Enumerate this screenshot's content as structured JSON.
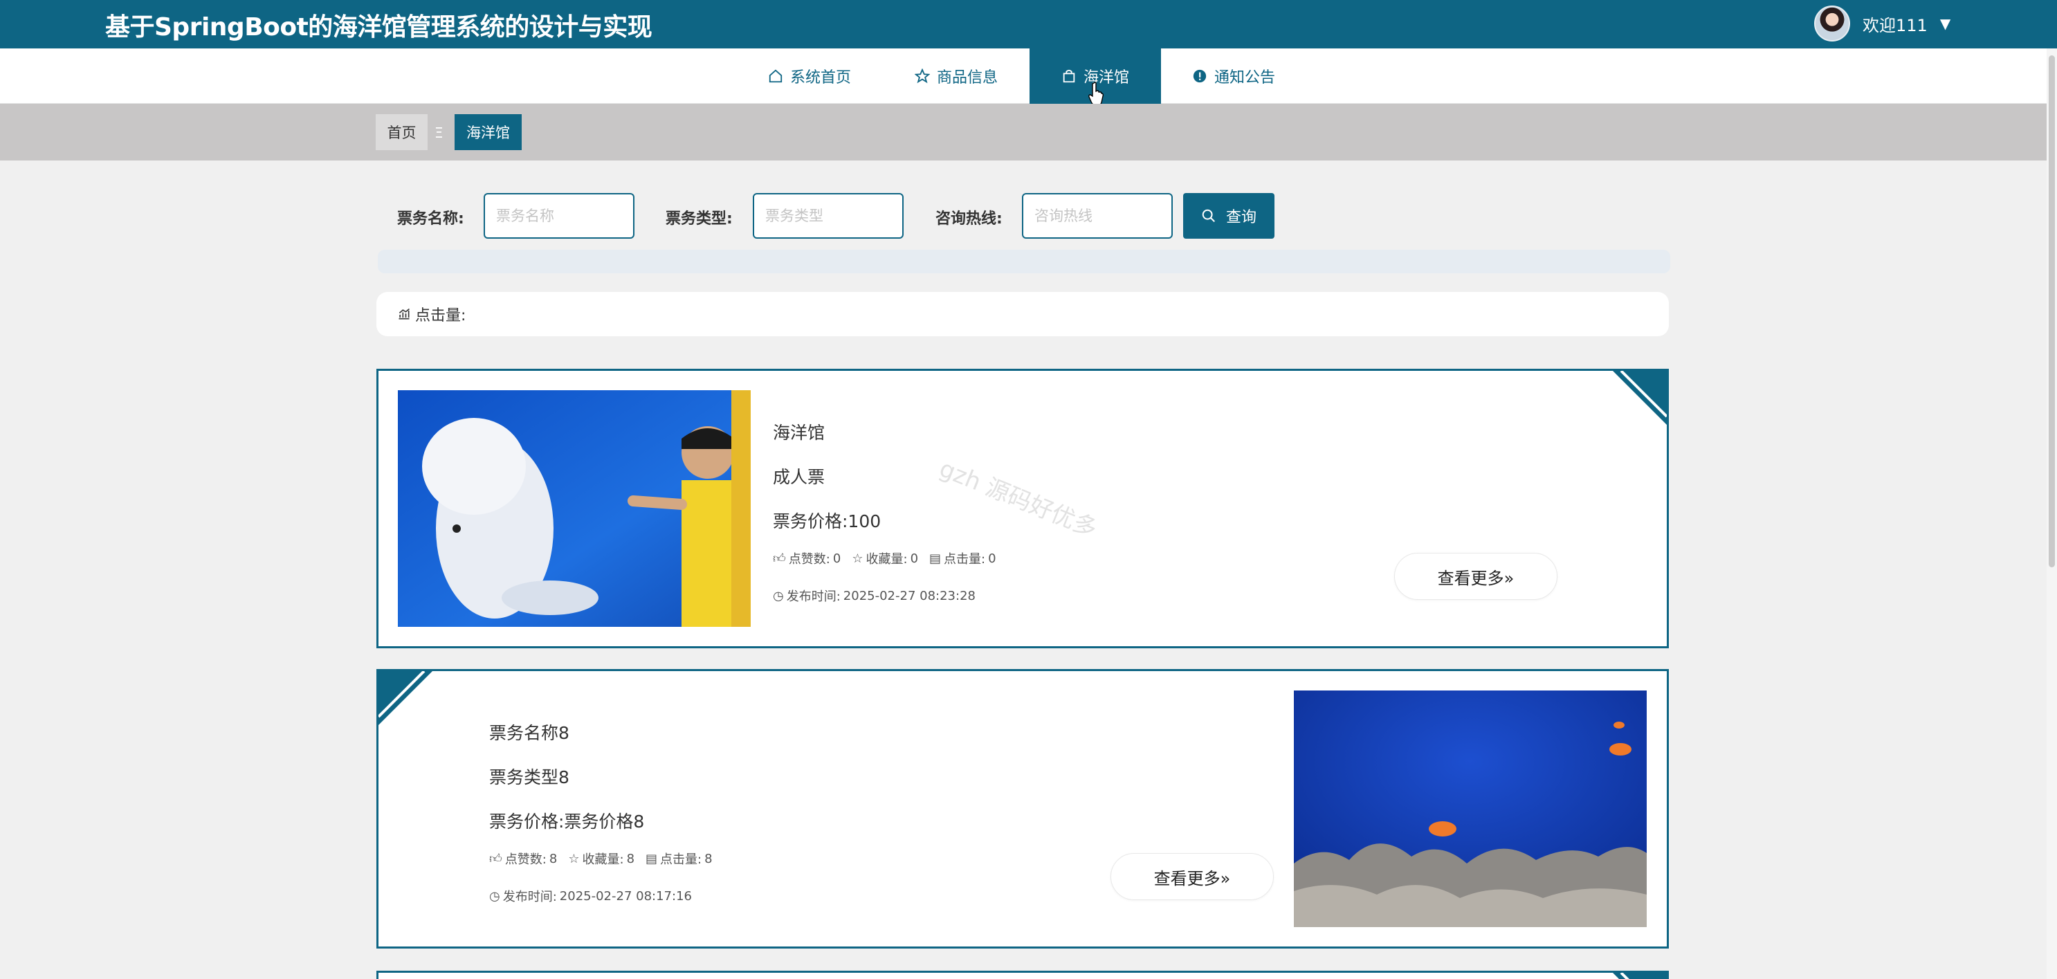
{
  "header": {
    "site_title": "基于SpringBoot的海洋馆管理系统的设计与实现",
    "welcome": "欢迎111",
    "caret": "▼",
    "avatar_icon": "user-avatar"
  },
  "nav": {
    "items": [
      {
        "label": "系统首页",
        "icon": "home-icon"
      },
      {
        "label": "商品信息",
        "icon": "star-icon"
      },
      {
        "label": "海洋馆",
        "icon": "bag-icon",
        "active": true
      },
      {
        "label": "通知公告",
        "icon": "alert-icon"
      }
    ]
  },
  "breadcrumb": {
    "home": "首页",
    "separator": "Ξ",
    "current": "海洋馆"
  },
  "search": {
    "name_label": "票务名称:",
    "name_placeholder": "票务名称",
    "type_label": "票务类型:",
    "type_placeholder": "票务类型",
    "hotline_label": "咨询热线:",
    "hotline_placeholder": "咨询热线",
    "button_label": "查询"
  },
  "sort": {
    "label": "点击量:"
  },
  "cards": [
    {
      "name": "海洋馆",
      "type": "成人票",
      "price": "票务价格:100",
      "likes_label": "点赞数:",
      "likes": "0",
      "favs_label": "收藏量:",
      "favs": "0",
      "clicks_label": "点击量:",
      "clicks": "0",
      "pub_label": "发布时间:",
      "pub_time": "2025-02-27 08:23:28",
      "more": "查看更多»"
    },
    {
      "name": "票务名称8",
      "type": "票务类型8",
      "price": "票务价格:票务价格8",
      "likes_label": "点赞数:",
      "likes": "8",
      "favs_label": "收藏量:",
      "favs": "8",
      "clicks_label": "点击量:",
      "clicks": "8",
      "pub_label": "发布时间:",
      "pub_time": "2025-02-27 08:17:16",
      "more": "查看更多»"
    }
  ],
  "watermark": "gzh 源码好优多",
  "colors": {
    "brand": "#0e6584",
    "page_bg": "#f0f0f0",
    "crumb_strip": "#c8c6c6"
  }
}
